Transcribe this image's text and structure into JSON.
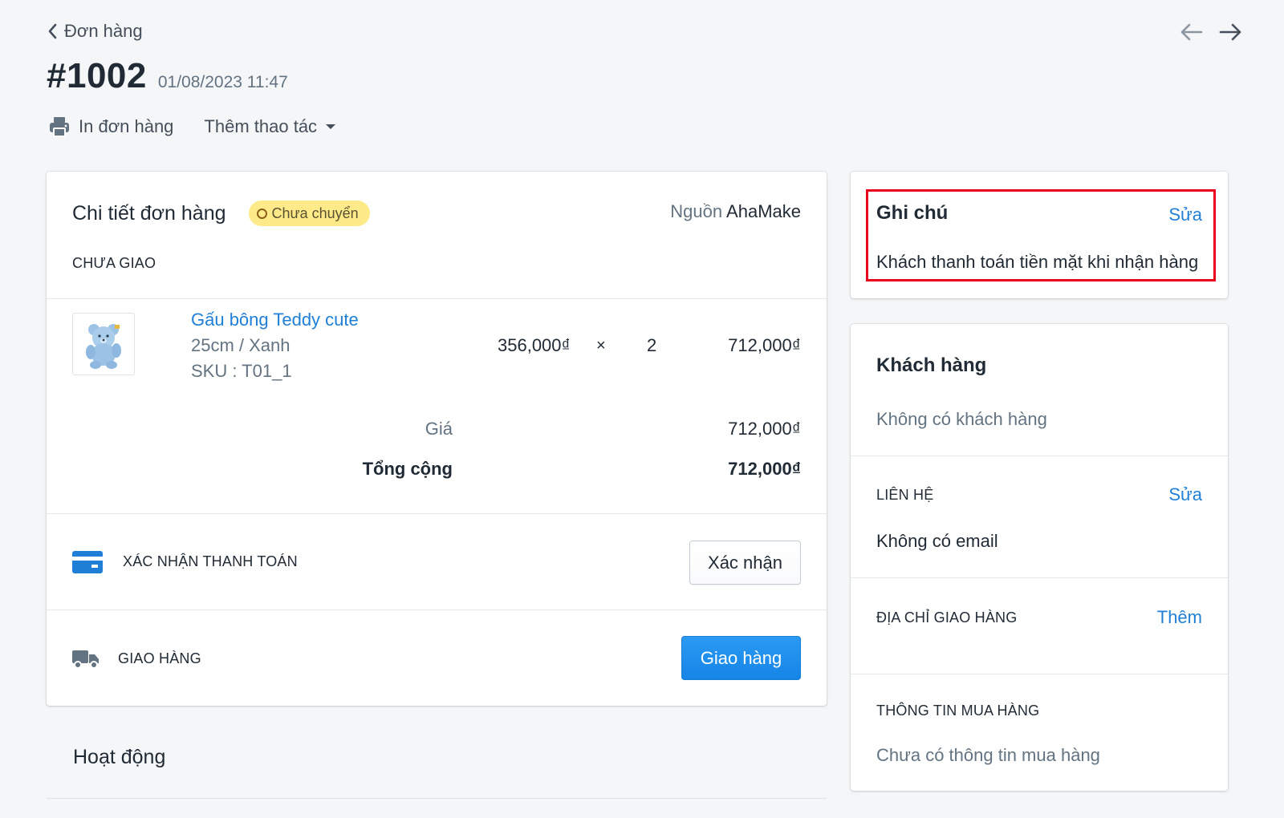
{
  "header": {
    "back_label": "Đơn hàng",
    "order_number": "#1002",
    "order_datetime": "01/08/2023 11:47",
    "print_label": "In đơn hàng",
    "more_actions_label": "Thêm thao tác"
  },
  "order_detail": {
    "title": "Chi tiết đơn hàng",
    "status_badge": "Chưa chuyển",
    "source_prefix": "Nguồn",
    "source_name": "AhaMake",
    "fulfillment_status": "CHƯA GIAO",
    "item": {
      "name": "Gấu bông Teddy cute",
      "variant": "25cm / Xanh",
      "sku": "SKU : T01_1",
      "unit_price": "356,000₫",
      "times": "×",
      "quantity": "2",
      "line_total": "712,000₫"
    },
    "subtotal_label": "Giá",
    "subtotal_value": "712,000₫",
    "total_label": "Tổng cộng",
    "total_value": "712,000₫",
    "payment_label": "XÁC NHẬN THANH TOÁN",
    "payment_button": "Xác nhận",
    "shipping_label": "GIAO HÀNG",
    "shipping_button": "Giao hàng"
  },
  "activity": {
    "title": "Hoạt động"
  },
  "notes": {
    "title": "Ghi chú",
    "edit_label": "Sửa",
    "text": "Khách thanh toán tiền mặt khi nhận hàng"
  },
  "customer": {
    "title": "Khách hàng",
    "empty_text": "Không có khách hàng",
    "contact_label": "LIÊN HỆ",
    "contact_edit": "Sửa",
    "contact_empty": "Không có email",
    "shipping_address_label": "ĐỊA CHỈ GIAO HÀNG",
    "shipping_address_add": "Thêm",
    "purchase_info_label": "THÔNG TIN MUA HÀNG",
    "purchase_info_empty": "Chưa có thông tin mua hàng"
  },
  "colors": {
    "accent": "#1f7fd6",
    "primary_button": "#1584e6",
    "badge_bg": "#ffea8a",
    "highlight": "#e8001c",
    "background": "#f4f6f8"
  },
  "icons": {
    "back": "chevron-left-icon",
    "prev": "arrow-left-icon",
    "next": "arrow-right-icon",
    "print": "printer-icon",
    "dropdown": "caret-down-icon",
    "payment": "credit-card-icon",
    "shipping": "truck-icon"
  }
}
